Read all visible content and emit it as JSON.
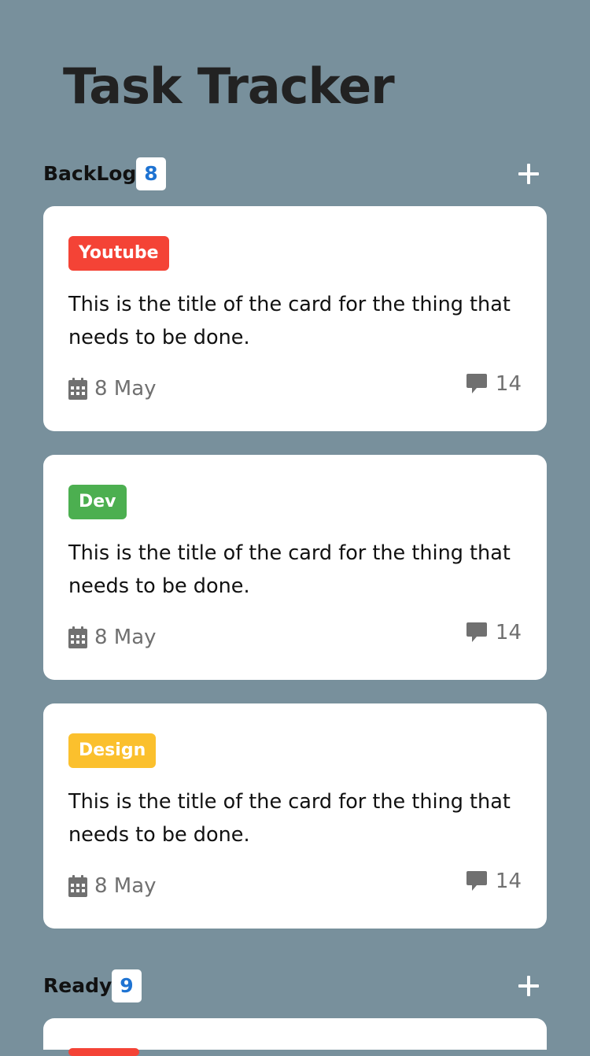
{
  "app": {
    "title": "Task Tracker"
  },
  "columns": [
    {
      "title": "BackLog",
      "count": "8",
      "cards": [
        {
          "tag": "Youtube",
          "tag_color": "#f44336",
          "title": "This is the title of the card for the thing that needs to be done.",
          "date": "8 May",
          "comments": "14"
        },
        {
          "tag": "Dev",
          "tag_color": "#4caf50",
          "title": "This is the title of the card for the thing that needs to be done.",
          "date": "8 May",
          "comments": "14"
        },
        {
          "tag": "Design",
          "tag_color": "#fbc02d",
          "title": "This is the title of the card for the thing that needs to be done.",
          "date": "8 May",
          "comments": "14"
        }
      ]
    },
    {
      "title": "Ready",
      "count": "9",
      "cards": [
        {
          "tag": "",
          "tag_color": "#f44336",
          "title": "",
          "date": "",
          "comments": ""
        }
      ]
    }
  ],
  "colors": {
    "background": "#78909c",
    "card": "#ffffff",
    "count_text": "#1e73d2",
    "meta_text": "#707070"
  },
  "icons": {
    "add": "plus-icon",
    "date": "calendar-icon",
    "comments": "comment-icon"
  }
}
